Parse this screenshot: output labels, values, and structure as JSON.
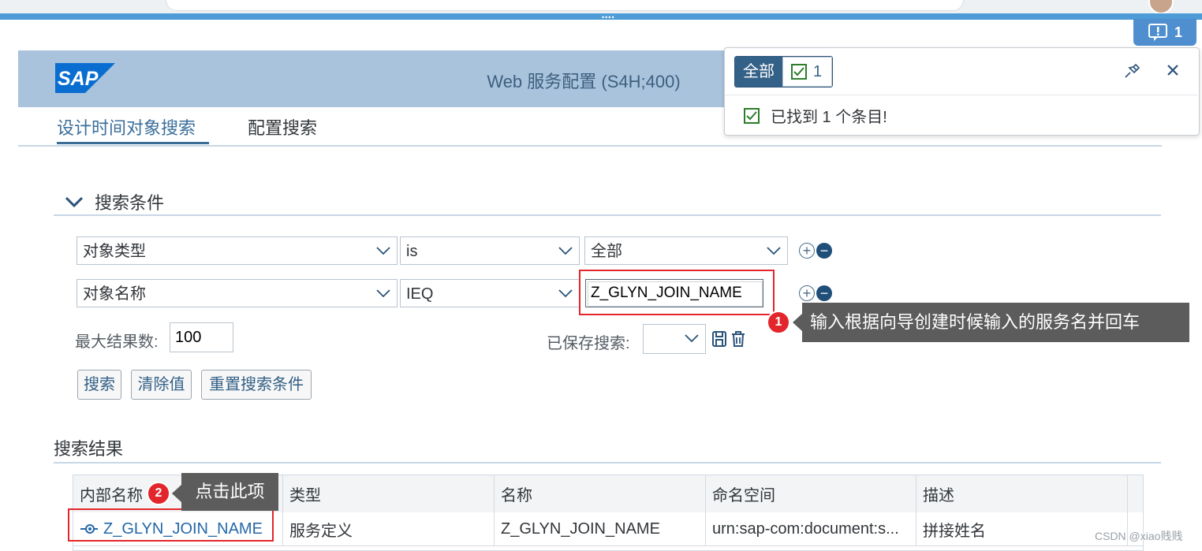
{
  "notification_button": {
    "count": "1"
  },
  "header": {
    "logo_text": "SAP",
    "title": "Web 服务配置 (S4H;400)"
  },
  "tabs": [
    {
      "label": "设计时间对象搜索",
      "active": true
    },
    {
      "label": "配置搜索",
      "active": false
    }
  ],
  "search_section": {
    "title": "搜索条件"
  },
  "criteria": [
    {
      "field": "对象类型",
      "operator": "is",
      "value": "全部"
    },
    {
      "field": "对象名称",
      "operator": "IEQ",
      "value": "Z_GLYN_JOIN_NAME"
    }
  ],
  "max_results": {
    "label": "最大结果数:",
    "value": "100"
  },
  "saved_search": {
    "label": "已保存搜索:",
    "value": ""
  },
  "buttons": {
    "search": "搜索",
    "clear": "清除值",
    "reset": "重置搜索条件"
  },
  "results": {
    "title": "搜索结果",
    "columns": [
      "内部名称",
      "类型",
      "名称",
      "命名空间",
      "描述"
    ],
    "rows": [
      {
        "internal_name": "Z_GLYN_JOIN_NAME",
        "type": "服务定义",
        "name": "Z_GLYN_JOIN_NAME",
        "namespace": "urn:sap-com:document:s...",
        "description": "拼接姓名"
      }
    ]
  },
  "notification_popover": {
    "filter_all": "全部",
    "filter_success_count": "1",
    "message": "已找到 1 个条目!"
  },
  "callouts": [
    {
      "number": "1",
      "text": "输入根据向导创建时候输入的服务名并回车"
    },
    {
      "number": "2",
      "text": "点击此项"
    }
  ],
  "watermark": "CSDN @xiao贱贱",
  "colors": {
    "shell_header": "#a9c3dd",
    "accent": "#346187",
    "callout_red": "#e2262b",
    "tooltip_bg": "#5c5c5c"
  }
}
